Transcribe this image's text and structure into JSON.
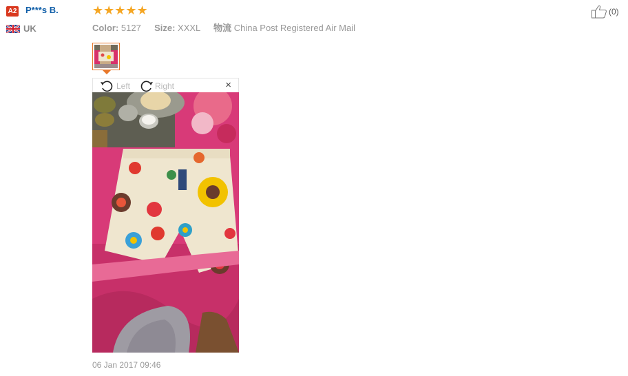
{
  "buyer": {
    "level_badge": "A2",
    "name": "P***s B.",
    "country": "UK",
    "flag_icon": "uk-flag-icon"
  },
  "review": {
    "rating": 5,
    "stars": "★★★★★",
    "star_color": "#f5a623",
    "color_label": "Color:",
    "color_value": "5127",
    "size_label": "Size:",
    "size_value": "XXXL",
    "shipping_label": "物流",
    "shipping_value": "China Post Registered Air Mail",
    "helpful_count": "(0)",
    "date": "06 Jan 2017 09:46"
  },
  "viewer": {
    "rotate_left_label": "Left",
    "rotate_right_label": "Right",
    "close_symbol": "×",
    "accent_color": "#e8782b"
  }
}
